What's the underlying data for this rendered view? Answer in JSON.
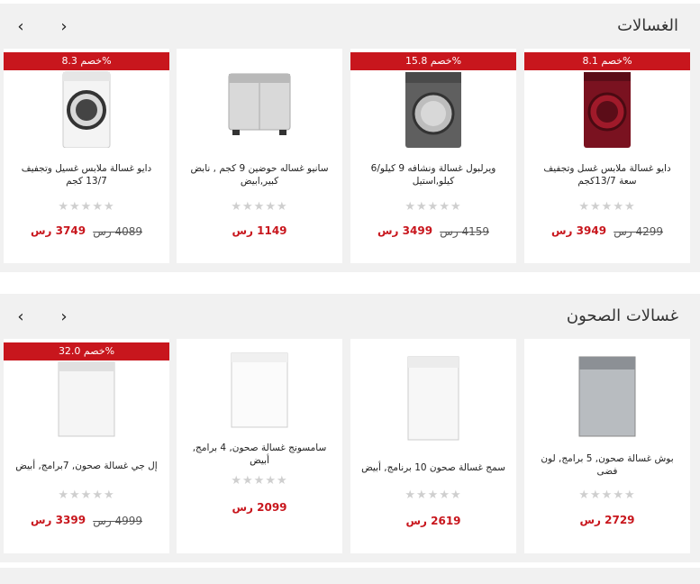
{
  "colors": {
    "accent": "#c8161d",
    "panel_bg": "#f1f1f1",
    "star": "#cfcfcf"
  },
  "nav": {
    "prev_icon": "chevron-left-icon",
    "next_icon": "chevron-right-icon",
    "prev_glyph": "‹",
    "next_glyph": "›"
  },
  "sections": [
    {
      "title": "الغسالات",
      "products": [
        {
          "name": "دايو غسالة ملابس غسل وتجفيف سعة 13/7كجم",
          "badge": "خصم 8.1%",
          "old_price": "4299 رس",
          "price": "3949 رس",
          "rating": 0
        },
        {
          "name": "ويرلبول غسالة ونشافه 9 كيلو/6 كيلو,استيل",
          "badge": "خصم 15.8%",
          "old_price": "4159 رس",
          "price": "3499 رس",
          "rating": 0
        },
        {
          "name": "سانيو غساله حوضين 9 كجم , نابض كبير,ابيض",
          "badge": "",
          "old_price": "",
          "price": "1149 رس",
          "rating": 0
        },
        {
          "name": "دايو غسالة ملابس غسيل وتجفيف 13/7 كجم",
          "badge": "خصم 8.3%",
          "old_price": "4089 رس",
          "price": "3749 رس",
          "rating": 0
        }
      ]
    },
    {
      "title": "غسالات الصحون",
      "products": [
        {
          "name": "بوش غسالة صحون, 5 برامج, لون فضى",
          "badge": "",
          "old_price": "",
          "price": "2729 رس",
          "rating": 0
        },
        {
          "name": "سمج غسالة صحون 10 برنامج, أبيض",
          "badge": "",
          "old_price": "",
          "price": "2619 رس",
          "rating": 0
        },
        {
          "name": "سامسونج غسالة صحون, 4 برامج, أبيض",
          "badge": "",
          "old_price": "",
          "price": "2099 رس",
          "rating": 0
        },
        {
          "name": "إل جي غسالة صحون, 7برامج, أبيض",
          "badge": "خصم 32.0%",
          "old_price": "4999 رس",
          "price": "3399 رس",
          "rating": 0
        }
      ]
    }
  ]
}
